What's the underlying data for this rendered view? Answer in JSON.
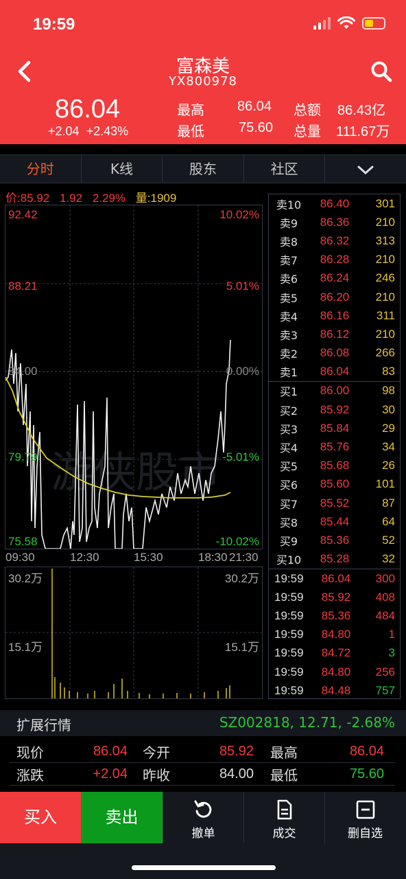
{
  "status": {
    "time": "19:59"
  },
  "header": {
    "name": "富森美",
    "code": "YX800978",
    "price": "86.04",
    "change": "+2.04",
    "change_pct": "+2.43%",
    "high_label": "最高",
    "high": "86.04",
    "low_label": "最低",
    "low": "75.60",
    "amount_label": "总额",
    "amount": "86.43亿",
    "volume_label": "总量",
    "volume": "111.67万"
  },
  "tabs": [
    "分时",
    "K线",
    "股东",
    "社区"
  ],
  "info": {
    "price": "价:85.92",
    "chg": "1.92",
    "pct": "2.29%",
    "vol": "量:1909"
  },
  "chart": {
    "top_price": "92.42",
    "top_pct": "10.02%",
    "mid_price": "88.21",
    "mid_pct": "5.01%",
    "base_price": "84.00",
    "base_pct": "0.00%",
    "low1_price": "79.79",
    "low1_pct": "-5.01%",
    "low2_price": "75.58",
    "low2_pct": "-10.02%",
    "watermark": "游侠股市",
    "times": [
      "09:30",
      "12:30",
      "15:30",
      "18:30",
      "21:30"
    ],
    "vol_top": "30.2万",
    "vol_mid": "15.1万"
  },
  "chart_data": {
    "type": "line",
    "x": [
      "09:30",
      "12:30",
      "15:30",
      "18:30",
      "21:30"
    ],
    "ylim": [
      75.58,
      92.42
    ],
    "series": []
  },
  "orderbook": {
    "asks": [
      {
        "label": "卖10",
        "price": "86.40",
        "vol": "301"
      },
      {
        "label": "卖9",
        "price": "86.36",
        "vol": "210"
      },
      {
        "label": "卖8",
        "price": "86.32",
        "vol": "313"
      },
      {
        "label": "卖7",
        "price": "86.28",
        "vol": "210"
      },
      {
        "label": "卖6",
        "price": "86.24",
        "vol": "246"
      },
      {
        "label": "卖5",
        "price": "86.20",
        "vol": "210"
      },
      {
        "label": "卖4",
        "price": "86.16",
        "vol": "311"
      },
      {
        "label": "卖3",
        "price": "86.12",
        "vol": "210"
      },
      {
        "label": "卖2",
        "price": "86.08",
        "vol": "266"
      },
      {
        "label": "卖1",
        "price": "86.04",
        "vol": "83"
      }
    ],
    "bids": [
      {
        "label": "买1",
        "price": "86.00",
        "vol": "98"
      },
      {
        "label": "买2",
        "price": "85.92",
        "vol": "30"
      },
      {
        "label": "买3",
        "price": "85.84",
        "vol": "29"
      },
      {
        "label": "买4",
        "price": "85.76",
        "vol": "34"
      },
      {
        "label": "买5",
        "price": "85.68",
        "vol": "26"
      },
      {
        "label": "买6",
        "price": "85.60",
        "vol": "101"
      },
      {
        "label": "买7",
        "price": "85.52",
        "vol": "87"
      },
      {
        "label": "买8",
        "price": "85.44",
        "vol": "64"
      },
      {
        "label": "买9",
        "price": "85.36",
        "vol": "52"
      },
      {
        "label": "买10",
        "price": "85.28",
        "vol": "32"
      }
    ]
  },
  "trades": [
    {
      "time": "19:59",
      "price": "86.04",
      "vol": "300",
      "side": "buy"
    },
    {
      "time": "19:59",
      "price": "85.92",
      "vol": "408",
      "side": "buy"
    },
    {
      "time": "19:59",
      "price": "85.36",
      "vol": "484",
      "side": "buy"
    },
    {
      "time": "19:59",
      "price": "84.80",
      "vol": "1",
      "side": "buy"
    },
    {
      "time": "19:59",
      "price": "84.72",
      "vol": "3",
      "side": "sell"
    },
    {
      "time": "19:59",
      "price": "84.80",
      "vol": "256",
      "side": "buy"
    },
    {
      "time": "19:59",
      "price": "84.48",
      "vol": "757",
      "side": "sell"
    }
  ],
  "ext": {
    "title": "扩展行情",
    "right": "SZ002818,  12.71,  -2.68%"
  },
  "quote": {
    "r1": {
      "k1": "现价",
      "v1": "86.04",
      "k2": "今开",
      "v2": "85.92",
      "k3": "最高",
      "v3": "86.04"
    },
    "r2": {
      "k1": "涨跌",
      "v1": "+2.04",
      "k2": "昨收",
      "v2": "84.00",
      "k3": "最低",
      "v3": "75.60"
    }
  },
  "actions": {
    "buy": "买入",
    "sell": "卖出",
    "cancel": "撤单",
    "deals": "成交",
    "remove": "删自选"
  },
  "colors": {
    "up": "#f03c3c",
    "down": "#2bc43a",
    "accent": "#f23b3d",
    "avg": "#d8d02a"
  }
}
